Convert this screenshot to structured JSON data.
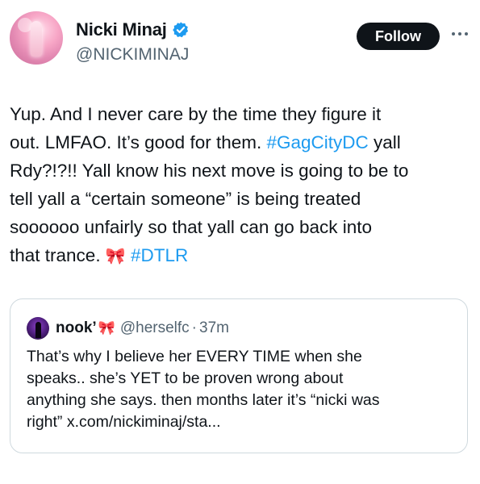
{
  "author": {
    "name": "Nicki Minaj",
    "handle": "@NICKIMINAJ",
    "verified_color": "#1d9bf0",
    "avatar_icon": "profile-photo-pink"
  },
  "actions": {
    "follow_label": "Follow",
    "more_icon": "more-dots-icon"
  },
  "tweet": {
    "line1": "Yup. And I never care by the time they figure it",
    "line2_a": "out. LMFAO. It’s good for them. ",
    "hashtag1": "#GagCityDC",
    "line2_b": " yall",
    "line3": "Rdy?!?!! Yall know his next move is going to be to",
    "line4": "tell yall a “certain someone” is being treated",
    "line5": "soooooo unfairly so that yall can go back into",
    "line6_a": "that trance. ",
    "bow_emoji": "🎀",
    "hashtag2": "#DTLR"
  },
  "quote": {
    "name": "nook’",
    "bow_emoji": "🎀",
    "handle": "@herselfc",
    "separator": "·",
    "time": "37m",
    "text": "That’s why I believe her EVERY TIME when she\nspeaks.. she’s YET to be proven wrong about\nanything she says. then months later it’s “nicki was\nright” x.com/nickiminaj/sta..."
  },
  "colors": {
    "link": "#1d9bf0",
    "text": "#0f1419",
    "secondary": "#536471",
    "border": "#cfd9de"
  }
}
